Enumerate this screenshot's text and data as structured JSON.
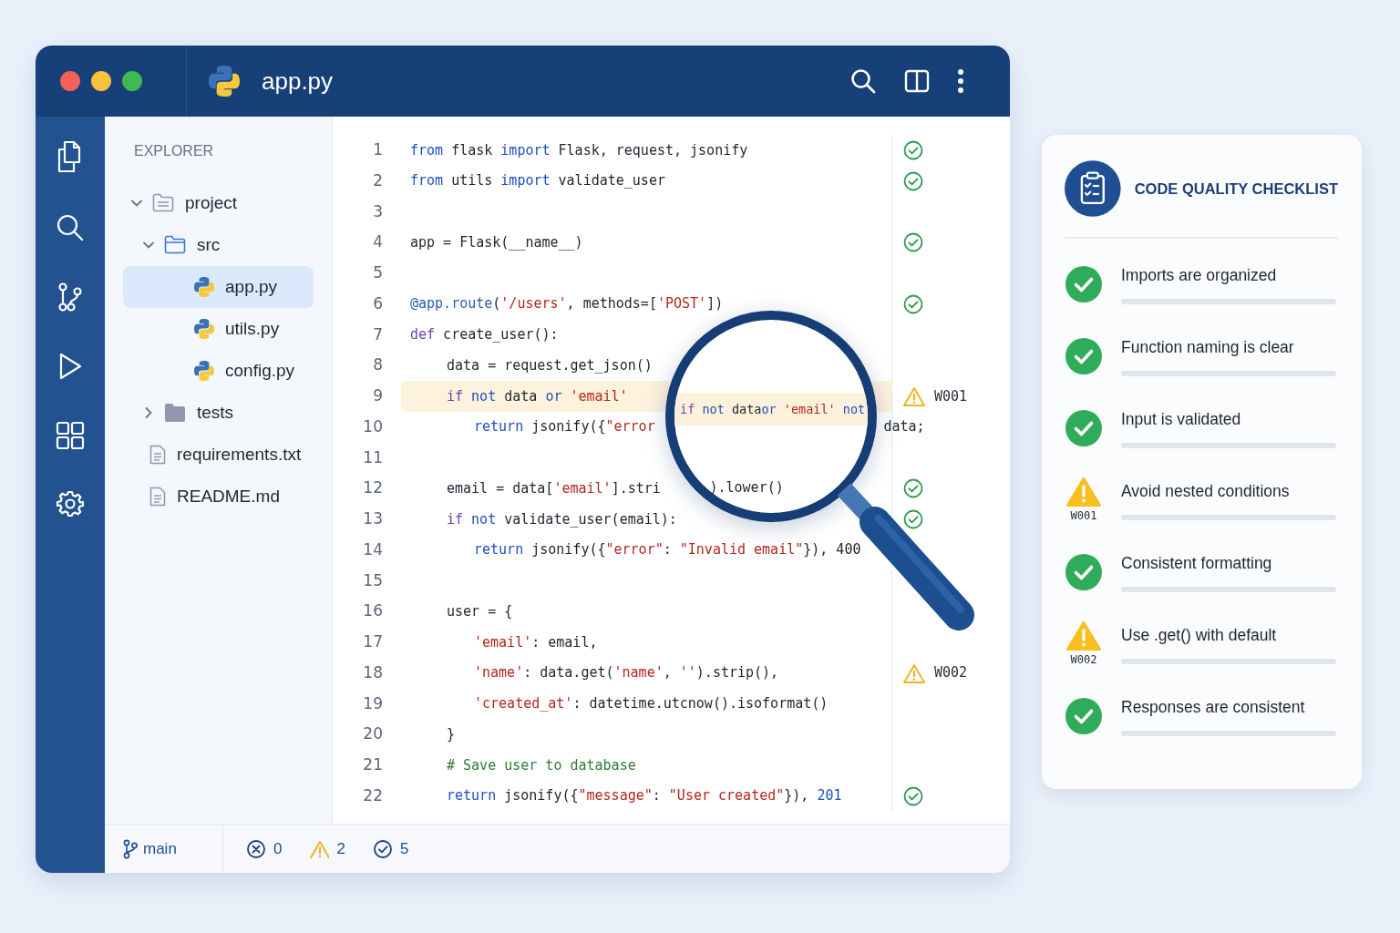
{
  "window": {
    "title": "app.py"
  },
  "explorer": {
    "title": "EXPLORER",
    "tree": [
      {
        "label": "project",
        "kind": "folder",
        "expanded": true,
        "selected": false,
        "children": [
          {
            "label": "src",
            "kind": "folder",
            "expanded": true,
            "selected": false,
            "children": [
              {
                "label": "app.py",
                "kind": "python",
                "selected": true
              },
              {
                "label": "utils.py",
                "kind": "python",
                "selected": false
              },
              {
                "label": "config.py",
                "kind": "python",
                "selected": false
              }
            ]
          },
          {
            "label": "tests",
            "kind": "folder",
            "expanded": false,
            "selected": false
          },
          {
            "label": "requirements.txt",
            "kind": "file",
            "selected": false
          },
          {
            "label": "README.md",
            "kind": "file",
            "selected": false
          }
        ]
      }
    ]
  },
  "editor": {
    "lines": [
      {
        "n": "1",
        "kind": "ok",
        "highlighted": false,
        "tokens": [
          {
            "kind": "kw",
            "text": "from"
          },
          {
            "kind": "plain",
            "text": " flask "
          },
          {
            "kind": "kw",
            "text": "import"
          },
          {
            "kind": "plain",
            "text": " Flask, request, jsonify"
          }
        ]
      },
      {
        "n": "2",
        "kind": "ok",
        "highlighted": false,
        "tokens": [
          {
            "kind": "kw",
            "text": "from"
          },
          {
            "kind": "plain",
            "text": " utils "
          },
          {
            "kind": "kw",
            "text": "import"
          },
          {
            "kind": "plain",
            "text": " validate_user"
          }
        ]
      },
      {
        "n": "3",
        "kind": "plain",
        "highlighted": false
      },
      {
        "n": "4",
        "kind": "ok",
        "highlighted": false,
        "tokens": [
          {
            "kind": "plain",
            "text": "app = Flask(__name__)"
          }
        ]
      },
      {
        "n": "5",
        "kind": "plain",
        "highlighted": false
      },
      {
        "n": "6",
        "kind": "ok",
        "highlighted": false,
        "tokens": [
          {
            "kind": "dec",
            "text": "@app.route"
          },
          {
            "kind": "plain",
            "text": "("
          },
          {
            "kind": "str",
            "text": "'/users'"
          },
          {
            "kind": "plain",
            "text": ", methods=["
          },
          {
            "kind": "str",
            "text": "'POST'"
          },
          {
            "kind": "plain",
            "text": "])"
          }
        ]
      },
      {
        "n": "7",
        "kind": "plain",
        "highlighted": false,
        "tokens": [
          {
            "kind": "ctl",
            "text": "def"
          },
          {
            "kind": "plain",
            "text": " create_user():"
          }
        ],
        "children": [
          {
            "n": "8",
            "kind": "plain",
            "highlighted": false,
            "tokens": [
              {
                "kind": "plain",
                "text": "data = request.get_json()"
              }
            ]
          },
          {
            "n": "9",
            "kind": "warn",
            "code": "W001",
            "highlighted": true,
            "tokens": [
              {
                "kind": "ctl",
                "text": "if"
              },
              {
                "kind": "kw",
                "text": " not"
              },
              {
                "kind": "plain",
                "text": " data "
              },
              {
                "kind": "kw",
                "text": "or"
              },
              {
                "kind": "str",
                "text": " 'email'"
              }
            ],
            "children": [
              {
                "n": "10",
                "kind": "plain",
                "highlighted": false,
                "tokens": [
                  {
                    "kind": "kw",
                    "text": "return"
                  },
                  {
                    "kind": "plain",
                    "text": " jsonify({"
                  },
                  {
                    "kind": "str",
                    "text": "\"error"
                  }
                ],
                "after_magnifier": [
                  {
                    "kind": "plain",
                    "text": "data;"
                  }
                ]
              }
            ]
          },
          {
            "n": "11",
            "kind": "plain",
            "highlighted": false
          },
          {
            "n": "12",
            "kind": "ok",
            "highlighted": false,
            "tokens": [
              {
                "kind": "plain",
                "text": "email = data["
              },
              {
                "kind": "str",
                "text": "'email'"
              },
              {
                "kind": "plain",
                "text": "].stri"
              }
            ],
            "after_magnifier": [
              {
                "kind": "plain",
                "text": ").lower()"
              }
            ]
          },
          {
            "n": "13",
            "kind": "ok",
            "highlighted": false,
            "tokens": [
              {
                "kind": "ctl",
                "text": "if"
              },
              {
                "kind": "kw",
                "text": " not"
              },
              {
                "kind": "plain",
                "text": " validate_user(email):"
              }
            ],
            "children": [
              {
                "n": "14",
                "kind": "plain",
                "highlighted": false,
                "tokens": [
                  {
                    "kind": "kw",
                    "text": "return"
                  },
                  {
                    "kind": "plain",
                    "text": " jsonify({"
                  },
                  {
                    "kind": "str",
                    "text": "\"error\""
                  },
                  {
                    "kind": "plain",
                    "text": ": "
                  },
                  {
                    "kind": "str",
                    "text": "\"Invalid email\""
                  },
                  {
                    "kind": "plain",
                    "text": "}), 400"
                  }
                ]
              }
            ]
          },
          {
            "n": "15",
            "kind": "plain",
            "highlighted": false
          },
          {
            "n": "16",
            "kind": "plain",
            "highlighted": false,
            "tokens": [
              {
                "kind": "plain",
                "text": "user = {"
              }
            ],
            "children": [
              {
                "n": "17",
                "kind": "plain",
                "highlighted": false,
                "tokens": [
                  {
                    "kind": "str",
                    "text": "'email'"
                  },
                  {
                    "kind": "plain",
                    "text": ": email,"
                  }
                ]
              },
              {
                "n": "18",
                "kind": "warn",
                "code": "W002",
                "highlighted": false,
                "tokens": [
                  {
                    "kind": "str",
                    "text": "'name'"
                  },
                  {
                    "kind": "plain",
                    "text": ": data.get("
                  },
                  {
                    "kind": "str",
                    "text": "'name'"
                  },
                  {
                    "kind": "plain",
                    "text": ", "
                  },
                  {
                    "kind": "str",
                    "text": "''"
                  },
                  {
                    "kind": "plain",
                    "text": ").strip(),"
                  }
                ]
              },
              {
                "n": "19",
                "kind": "plain",
                "highlighted": false,
                "tokens": [
                  {
                    "kind": "str",
                    "text": "'created_at'"
                  },
                  {
                    "kind": "plain",
                    "text": ": datetime.utcnow().isoformat()"
                  }
                ]
              }
            ]
          },
          {
            "n": "20",
            "kind": "plain",
            "highlighted": false,
            "tokens": [
              {
                "kind": "plain",
                "text": "}"
              }
            ]
          },
          {
            "n": "21",
            "kind": "plain",
            "highlighted": false,
            "tokens": [
              {
                "kind": "cmt",
                "text": "# Save user to database"
              }
            ]
          },
          {
            "n": "22",
            "kind": "ok",
            "highlighted": false,
            "tokens": [
              {
                "kind": "kw",
                "text": "return"
              },
              {
                "kind": "plain",
                "text": " jsonify({"
              },
              {
                "kind": "str",
                "text": "\"message\""
              },
              {
                "kind": "plain",
                "text": ": "
              },
              {
                "kind": "str",
                "text": "\"User created\""
              },
              {
                "kind": "plain",
                "text": "}), "
              },
              {
                "kind": "num",
                "text": "201"
              }
            ]
          }
        ]
      }
    ],
    "magnifier": {
      "tokens": [
        {
          "kind": "ctl",
          "text": "if"
        },
        {
          "kind": "kw",
          "text": " not"
        },
        {
          "kind": "plain",
          "text": " data"
        },
        {
          "kind": "kw",
          "text": "or"
        },
        {
          "kind": "str",
          "text": " 'email'"
        },
        {
          "kind": "kw",
          "text": " not"
        }
      ]
    }
  },
  "status_bar": {
    "branch": "main",
    "errors": "0",
    "warnings": "2",
    "passed": "5"
  },
  "checklist": {
    "title": "CODE QUALITY CHECKLIST",
    "items": [
      {
        "label": "Imports are organized",
        "kind": "pass"
      },
      {
        "label": "Function naming is clear",
        "kind": "pass"
      },
      {
        "label": "Input is validated",
        "kind": "pass"
      },
      {
        "label": "Avoid nested conditions",
        "kind": "warn",
        "code": "W001"
      },
      {
        "label": "Consistent formatting",
        "kind": "pass"
      },
      {
        "label": "Use .get() with default",
        "kind": "warn",
        "code": "W002"
      },
      {
        "label": "Responses are consistent",
        "kind": "pass"
      }
    ]
  }
}
